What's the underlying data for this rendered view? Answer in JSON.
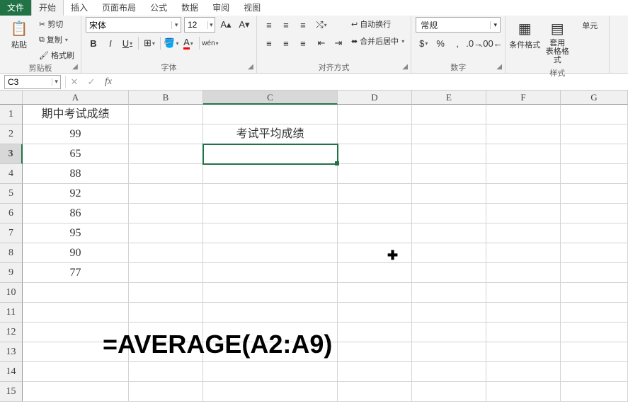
{
  "tabs": {
    "file": "文件",
    "home": "开始",
    "insert": "插入",
    "page_layout": "页面布局",
    "formulas": "公式",
    "data": "数据",
    "review": "审阅",
    "view": "视图"
  },
  "clipboard": {
    "paste": "粘贴",
    "cut": "剪切",
    "copy": "复制",
    "format_painter": "格式刷",
    "label": "剪贴板"
  },
  "font": {
    "name": "宋体",
    "size": "12",
    "wen": "wén",
    "label": "字体"
  },
  "align": {
    "wrap": "自动换行",
    "merge": "合并后居中",
    "label": "对齐方式"
  },
  "number": {
    "format": "常规",
    "label": "数字"
  },
  "styles": {
    "cond_fmt": "条件格式",
    "table_fmt": "套用\n表格格式",
    "cell": "单元",
    "label": "样式"
  },
  "namebox": "C3",
  "formula_value": "",
  "columns": [
    "A",
    "B",
    "C",
    "D",
    "E",
    "F",
    "G"
  ],
  "row_nums": [
    "1",
    "2",
    "3",
    "4",
    "5",
    "6",
    "7",
    "8",
    "9",
    "10",
    "11",
    "12",
    "13",
    "14",
    "15"
  ],
  "cells": {
    "A1": "期中考试成绩",
    "A2": "99",
    "A3": "65",
    "A4": "88",
    "A5": "92",
    "A6": "86",
    "A7": "95",
    "A8": "90",
    "A9": "77",
    "C2": "考试平均成绩"
  },
  "selected_cell": "C3",
  "overlay_formula": "=AVERAGE(A2:A9)"
}
